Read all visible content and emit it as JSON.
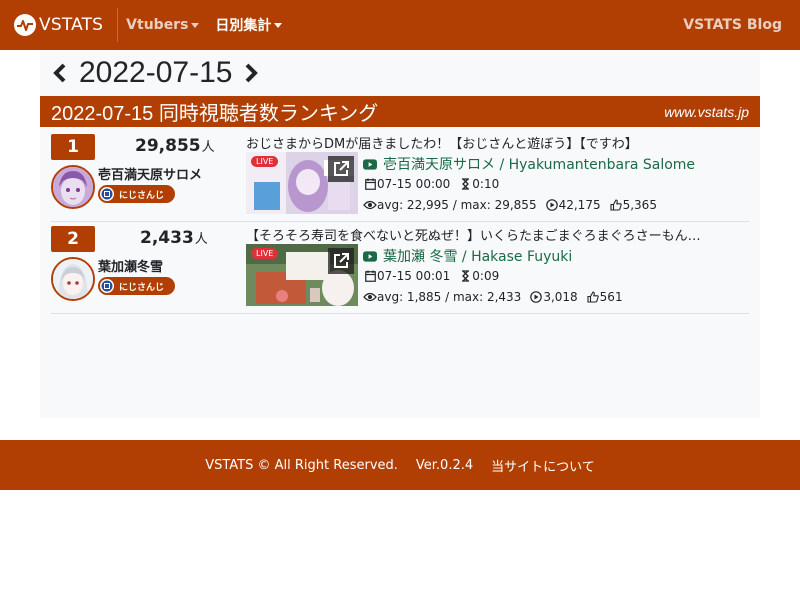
{
  "nav": {
    "brand": "VSTATS",
    "items": [
      "Vtubers",
      "日別集計"
    ],
    "right_link": "VSTATS Blog"
  },
  "date": "2022-07-15",
  "ranking": {
    "title": "2022-07-15 同時視聴者数ランキング",
    "site": "www.vstats.jp",
    "unit": "人",
    "rows": [
      {
        "rank": "1",
        "viewers": "29,855",
        "vtuber": "壱百満天原サロメ",
        "office": "にじさんじ",
        "stream_title": "おじさまからDMが届きましたわ！【おじさんと遊ぼう】【ですわ】",
        "live": "LIVE",
        "channel": "壱百満天原サロメ / Hyakumantenbara Salome",
        "start": "07-15 00:00",
        "duration": "0:10",
        "avg_max": "avg: 22,995 / max: 29,855",
        "views": "42,175",
        "likes": "5,365"
      },
      {
        "rank": "2",
        "viewers": "2,433",
        "vtuber": "葉加瀬冬雪",
        "office": "にじさんじ",
        "stream_title": "【そろそろ寿司を食べないと死ぬぜ！】いくらたまごまぐろまぐろさーもん…",
        "live": "LIVE",
        "channel": "葉加瀬 冬雪 / Hakase Fuyuki",
        "start": "07-15 00:01",
        "duration": "0:09",
        "avg_max": "avg: 1,885 / max: 2,433",
        "views": "3,018",
        "likes": "561"
      }
    ]
  },
  "footer": {
    "copyright": "VSTATS © All Right Reserved.",
    "version": "Ver.0.2.4",
    "about": "当サイトについて"
  },
  "colors": {
    "brand": "#b13f03",
    "channel_link": "#1a6a48",
    "live": "#e0303a"
  },
  "icons": [
    "pulse-logo-icon",
    "chevron-left-icon",
    "chevron-right-icon",
    "youtube-icon",
    "calendar-icon",
    "hourglass-icon",
    "eye-icon",
    "play-circle-icon",
    "thumbs-up-icon",
    "external-link-icon",
    "nijisanji-logo-icon"
  ]
}
